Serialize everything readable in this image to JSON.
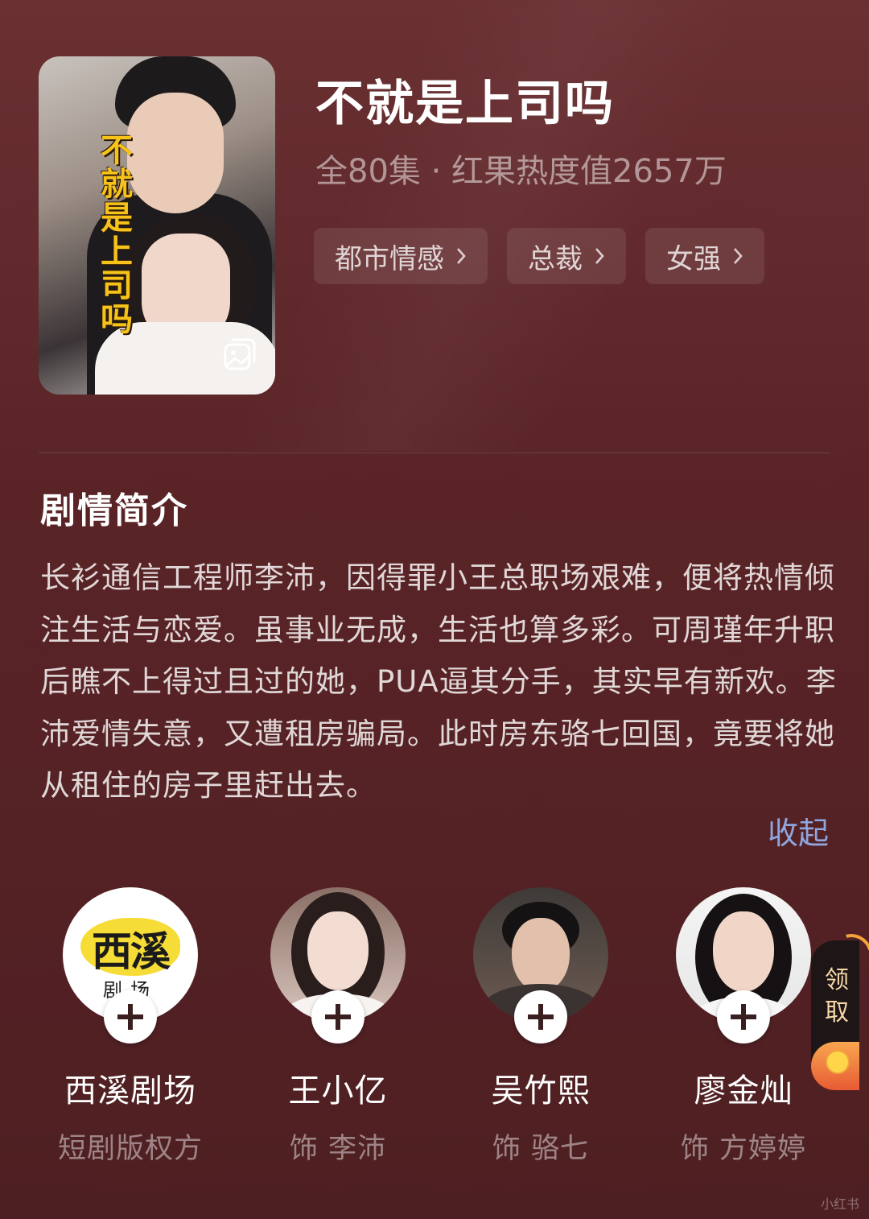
{
  "drama": {
    "title": "不就是上司吗",
    "poster_title": "不就是上司吗",
    "subtitle": "全80集 · 红果热度值2657万",
    "tags": [
      {
        "label": "都市情感"
      },
      {
        "label": "总裁"
      },
      {
        "label": "女强"
      }
    ]
  },
  "synopsis": {
    "heading": "剧情简介",
    "text": "长衫通信工程师李沛，因得罪小王总职场艰难，便将热情倾注生活与恋爱。虽事业无成，生活也算多彩。可周瑾年升职后瞧不上得过且过的她，PUA逼其分手，其实早有新欢。李沛爱情失意，又遭租房骗局。此时房东骆七回国，竟要将她从租住的房子里赶出去。",
    "collapse_label": "收起"
  },
  "cast": [
    {
      "name": "西溪剧场",
      "role": "短剧版权方",
      "avatar_text_main": "西溪",
      "avatar_text_sub": "剧场"
    },
    {
      "name": "王小亿",
      "role": "饰 李沛"
    },
    {
      "name": "吴竹熙",
      "role": "饰 骆七"
    },
    {
      "name": "廖金灿",
      "role": "饰 方婷婷"
    }
  ],
  "widget": {
    "label": "领取"
  },
  "watermark": "小红书",
  "icons": {
    "poster_corner": "gallery-icon",
    "tag_arrow": "chevron-right-icon",
    "follow": "plus-icon",
    "widget": "red-envelope-icon"
  },
  "colors": {
    "background": "#5a2427",
    "link": "#8fa6e0",
    "poster_title": "#f7c31a"
  }
}
